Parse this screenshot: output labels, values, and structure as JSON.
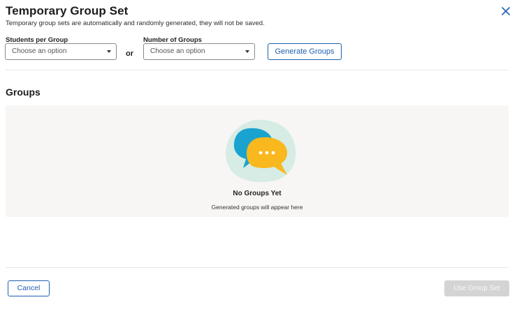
{
  "header": {
    "title": "Temporary Group Set",
    "subtitle": "Temporary group sets are automatically and randomly generated, they will not be saved."
  },
  "form": {
    "students_per_group": {
      "label": "Students per Group",
      "value": "Choose an option"
    },
    "or_label": "or",
    "number_of_groups": {
      "label": "Number of Groups",
      "value": "Choose an option"
    },
    "generate_button": "Generate Groups"
  },
  "groups": {
    "heading": "Groups",
    "empty_title": "No Groups Yet",
    "empty_text": "Generated groups will appear here",
    "empty_icon": "chat-bubbles-icon"
  },
  "footer": {
    "cancel_label": "Cancel",
    "use_label": "Use Group Set"
  },
  "colors": {
    "accent": "#1f5fb4",
    "bubble_blue": "#1ba3cf",
    "bubble_yellow": "#f9b81d",
    "blob_green": "#d6ece5",
    "panel_bg": "#f7f6f4",
    "disabled_bg": "#d4d4d4"
  }
}
